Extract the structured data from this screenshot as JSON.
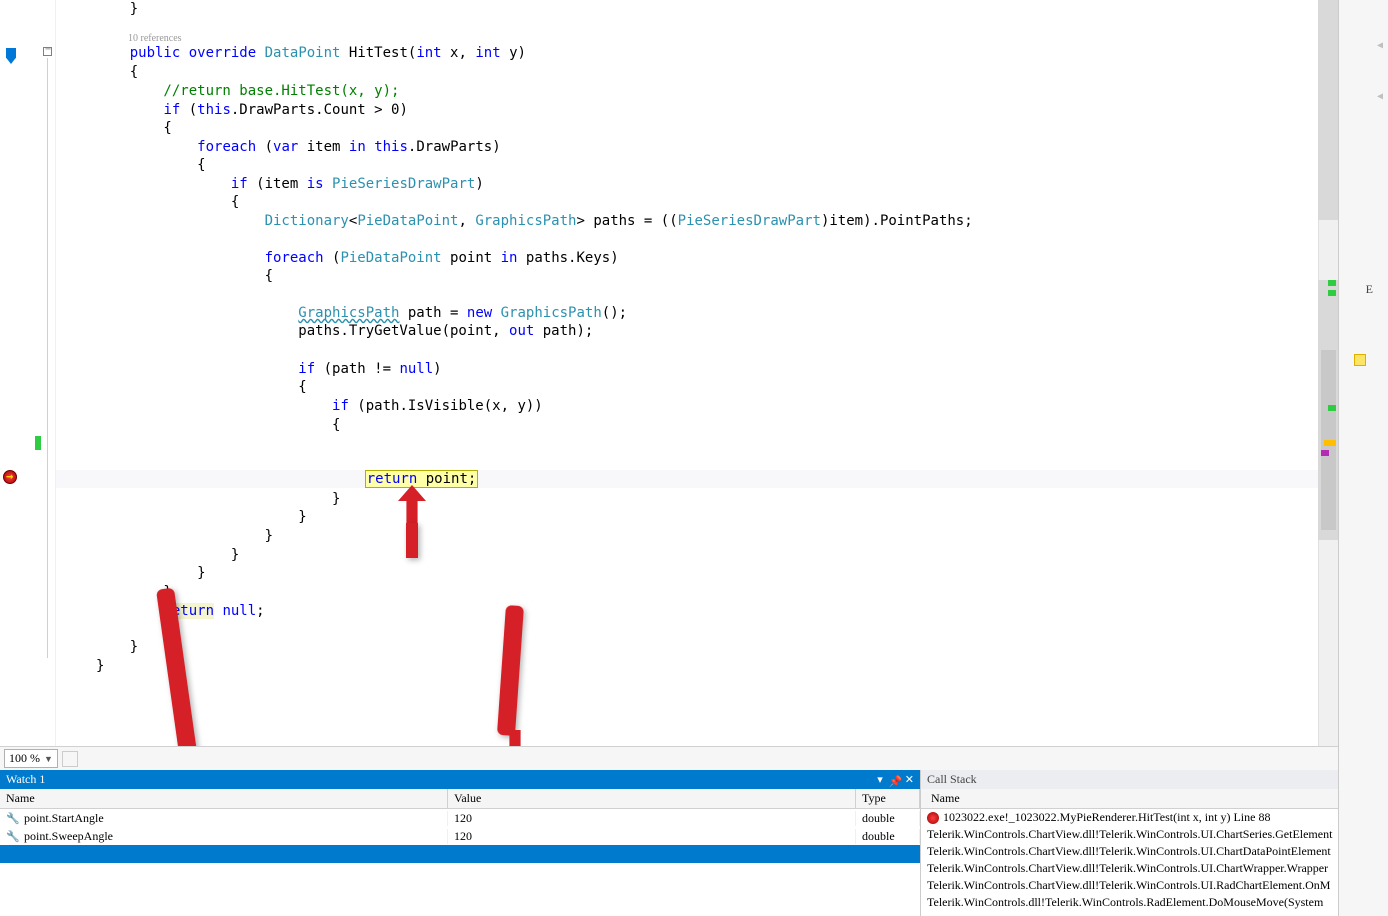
{
  "editor": {
    "codelens": "10 references",
    "lines": {
      "brace1_close": "    }",
      "blank": "",
      "sig_pre": "    ",
      "kw_public": "public",
      "kw_override": "override",
      "type_DataPoint": "DataPoint",
      "sig_post1": " HitTest(",
      "kw_int1": "int",
      "sig_x": " x, ",
      "kw_int2": "int",
      "sig_y": " y)",
      "open_brace": "    {",
      "comment": "        //return base.HitTest(x, y);",
      "if1_pre": "        ",
      "kw_if1": "if",
      "if1_cond_pre": " (",
      "kw_this1": "this",
      "if1_cond_post": ".DrawParts.Count > 0)",
      "open_brace2": "        {",
      "fe1_pre": "            ",
      "kw_foreach1": "foreach",
      "fe1_p1": " (",
      "kw_var": "var",
      "fe1_p2": " item ",
      "kw_in1": "in",
      "fe1_p3": " ",
      "kw_this2": "this",
      "fe1_p4": ".DrawParts)",
      "open_brace3": "            {",
      "ifis_pre": "                ",
      "kw_if2": "if",
      "ifis_p1": " (item ",
      "kw_is": "is",
      "ifis_p2": " ",
      "type_PieSeriesDrawPart": "PieSeriesDrawPart",
      "ifis_p3": ")",
      "open_brace4": "                {",
      "dict_pre": "                    ",
      "type_Dictionary": "Dictionary",
      "dict_p1": "<",
      "type_PieDataPoint1": "PieDataPoint",
      "dict_p2": ", ",
      "type_GraphicsPath1": "GraphicsPath",
      "dict_p3": "> paths = ((",
      "type_PieSeriesDrawPart2": "PieSeriesDrawPart",
      "dict_p4": ")item).PointPaths;",
      "fe2_pre": "                    ",
      "kw_foreach2": "foreach",
      "fe2_p1": " (",
      "type_PieDataPoint2": "PieDataPoint",
      "fe2_p2": " point ",
      "kw_in2": "in",
      "fe2_p3": " paths.Keys)",
      "open_brace5": "                    {",
      "gp_pre": "                        ",
      "type_GraphicsPathU": "GraphicsPath",
      "gp_p1": " path = ",
      "kw_new": "new",
      "gp_p2": " ",
      "type_GraphicsPath3": "GraphicsPath",
      "gp_p3": "();",
      "trygv": "                        paths.TryGetValue(point, ",
      "kw_out": "out",
      "trygv2": " path);",
      "if3_pre": "                        ",
      "kw_if3": "if",
      "if3_cond": " (path != ",
      "kw_null1": "null",
      "if3_end": ")",
      "open_brace6": "                        {",
      "if4_pre": "                            ",
      "kw_if4": "if",
      "if4_cond": " (path.IsVisible(x, y))",
      "open_brace7": "                            {",
      "ret_pre": "                                ",
      "kw_return1": "return",
      "ret_point": " point;",
      "close7": "                            }",
      "close6": "                        }",
      "close5": "                    }",
      "close4": "                }",
      "close3": "            }",
      "close2": "        }",
      "retnull_pre": "        ",
      "kw_return2": "return",
      "retnull_sp": " ",
      "kw_null2": "null",
      "retnull_end": ";",
      "close1": "    }",
      "close0": "}"
    }
  },
  "zoom": {
    "value": "100 %"
  },
  "watch": {
    "title": "Watch 1",
    "cols": {
      "name": "Name",
      "value": "Value",
      "type": "Type"
    },
    "rows": [
      {
        "name": "point.StartAngle",
        "value": "120",
        "type": "double"
      },
      {
        "name": "point.SweepAngle",
        "value": "120",
        "type": "double"
      }
    ]
  },
  "callstack": {
    "title": "Call Stack",
    "col": "Name",
    "rows": [
      "1023022.exe!_1023022.MyPieRenderer.HitTest(int x, int y) Line 88",
      "Telerik.WinControls.ChartView.dll!Telerik.WinControls.UI.ChartSeries.GetElement",
      "Telerik.WinControls.ChartView.dll!Telerik.WinControls.UI.ChartDataPointElement",
      "Telerik.WinControls.ChartView.dll!Telerik.WinControls.UI.ChartWrapper.Wrapper",
      "Telerik.WinControls.ChartView.dll!Telerik.WinControls.UI.RadChartElement.OnM",
      "Telerik.WinControls.dll!Telerik.WinControls.RadElement.DoMouseMove(System"
    ]
  },
  "right_sidebar": {
    "e": "E"
  }
}
